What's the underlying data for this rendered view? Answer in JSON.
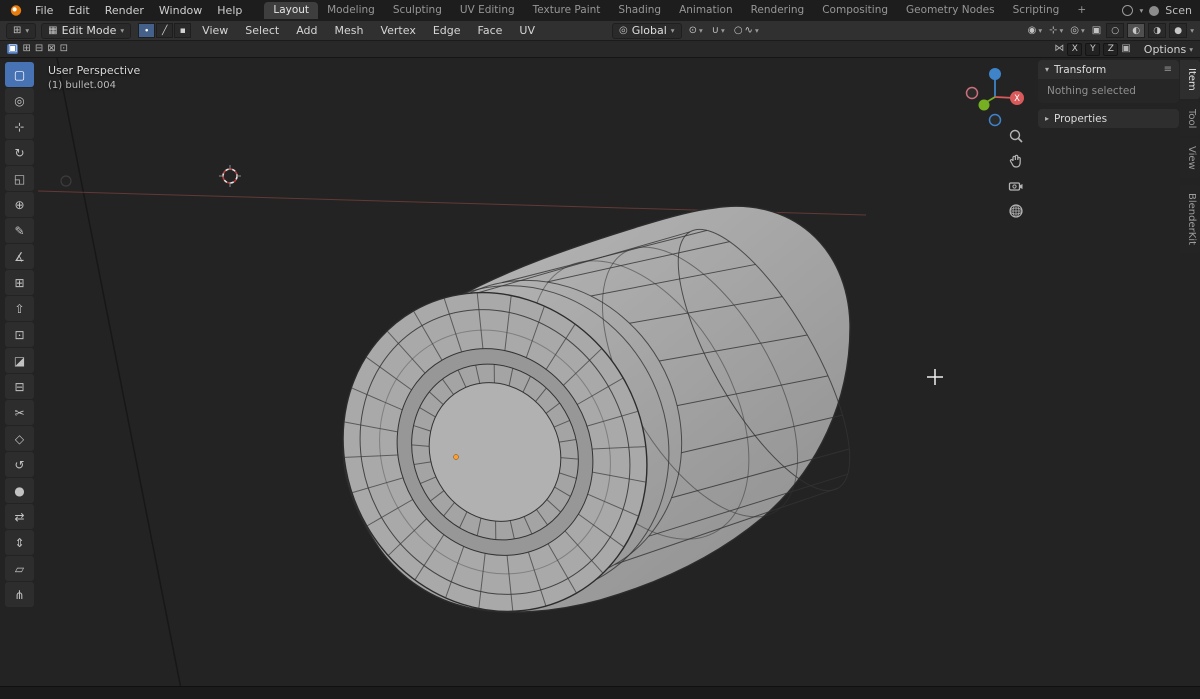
{
  "topbar": {
    "menus": [
      "File",
      "Edit",
      "Render",
      "Window",
      "Help"
    ],
    "workspaces": [
      "Layout",
      "Modeling",
      "Sculpting",
      "UV Editing",
      "Texture Paint",
      "Shading",
      "Animation",
      "Rendering",
      "Compositing",
      "Geometry Nodes",
      "Scripting"
    ],
    "add_workspace": "+",
    "scene_label": "Scen"
  },
  "header": {
    "mode": "Edit Mode",
    "select_modes": [
      {
        "name": "vertex",
        "glyph": "∙"
      },
      {
        "name": "edge",
        "glyph": "╱"
      },
      {
        "name": "face",
        "glyph": "▪"
      }
    ],
    "menus": [
      "View",
      "Select",
      "Add",
      "Mesh",
      "Vertex",
      "Edge",
      "Face",
      "UV"
    ],
    "orientation": "Global"
  },
  "tool_settings": {
    "axes": [
      "X",
      "Y",
      "Z"
    ],
    "options_label": "Options"
  },
  "viewport": {
    "view_label": "User Perspective",
    "object_label": "(1) bullet.004",
    "gizmo_x_label": "X"
  },
  "npanel": {
    "transform_title": "Transform",
    "empty_text": "Nothing selected",
    "properties_title": "Properties",
    "tabs": [
      "Item",
      "Tool",
      "View",
      "BlenderKit"
    ]
  },
  "toolbar": {
    "tools": [
      {
        "name": "select-box",
        "glyph": "▢",
        "active": true
      },
      {
        "name": "cursor",
        "glyph": "◎"
      },
      {
        "name": "move",
        "glyph": "⊹"
      },
      {
        "name": "rotate",
        "glyph": "↻"
      },
      {
        "name": "scale",
        "glyph": "◱"
      },
      {
        "name": "transform",
        "glyph": "⊕"
      },
      {
        "name": "annotate",
        "glyph": "✎"
      },
      {
        "name": "measure",
        "glyph": "∡"
      },
      {
        "name": "add-cube",
        "glyph": "⊞"
      },
      {
        "name": "extrude-region",
        "glyph": "⇧"
      },
      {
        "name": "inset-faces",
        "glyph": "⊡"
      },
      {
        "name": "bevel",
        "glyph": "◪"
      },
      {
        "name": "loop-cut",
        "glyph": "⊟"
      },
      {
        "name": "knife",
        "glyph": "✂"
      },
      {
        "name": "poly-build",
        "glyph": "◇"
      },
      {
        "name": "spin",
        "glyph": "↺"
      },
      {
        "name": "smooth",
        "glyph": "●"
      },
      {
        "name": "edge-slide",
        "glyph": "⇄"
      },
      {
        "name": "shrink-fatten",
        "glyph": "⇕"
      },
      {
        "name": "shear",
        "glyph": "▱"
      },
      {
        "name": "rip-region",
        "glyph": "⋔"
      }
    ]
  },
  "icons": {
    "editor_type": "⊞",
    "mode_cube": "▦",
    "orientation_globe": "◎",
    "pivot": "⊙",
    "magnet": "∪",
    "proportional": "○",
    "falloff": "∿",
    "visibility": "◉",
    "gizmos": "⊹",
    "overlays": "◎",
    "xray": "▣",
    "shading_wire": "○",
    "shading_solid": "◐",
    "shading_material": "◑",
    "shading_render": "●",
    "mirror": "⋈",
    "burger": "≡",
    "arrow_down": "▾",
    "arrow_right": "▸",
    "ts": [
      "▣",
      "⊞",
      "⊟",
      "⊠",
      "⊡"
    ]
  },
  "colors": {
    "accent": "#4772b3",
    "axis_x": "#d95a5a",
    "axis_y": "#76b022",
    "axis_z": "#3f83c9",
    "origin_orange": "#ff9d2e"
  }
}
